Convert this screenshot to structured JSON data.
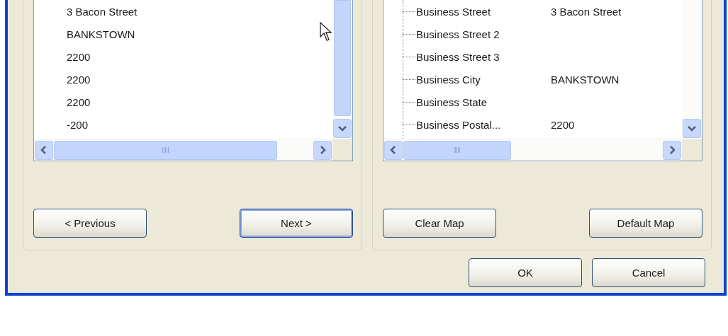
{
  "source_list": {
    "items": [
      "3 Bacon Street",
      "BANKSTOWN",
      "2200",
      "2200",
      "2200",
      "-200"
    ]
  },
  "source_buttons": [
    {
      "label": "< Previous",
      "default": false
    },
    {
      "label": "Next >",
      "default": true
    }
  ],
  "field_tree": {
    "rows": [
      {
        "field": "Business Street",
        "value": "3 Bacon Street"
      },
      {
        "field": "Business Street 2"
      },
      {
        "field": "Business Street 3"
      },
      {
        "field": "Business City",
        "value": "BANKSTOWN"
      },
      {
        "field": "Business State"
      },
      {
        "field": "Business Postal...",
        "value": "2200"
      }
    ]
  },
  "map_buttons": [
    {
      "label": "Clear Map",
      "default": false
    },
    {
      "label": "Default Map",
      "default": false
    }
  ],
  "dialog_buttons": [
    {
      "label": "OK",
      "default": false
    },
    {
      "label": "Cancel",
      "default": false
    }
  ]
}
